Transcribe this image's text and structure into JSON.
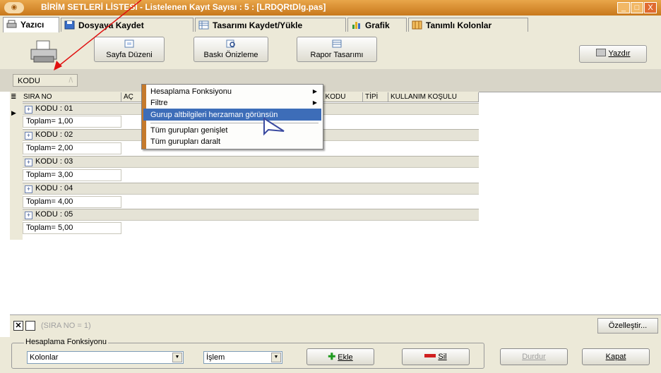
{
  "window": {
    "title": "BİRİM SETLERİ LİSTESİ  -  Listelenen Kayıt Sayısı : 5 : [LRDQRtDlg.pas]",
    "controls": [
      "_",
      "□",
      "X"
    ]
  },
  "tabs": [
    {
      "label": "Yazıcı",
      "icon": "printer-icon",
      "active": true
    },
    {
      "label": "Dosyaya Kaydet",
      "icon": "save-disk-icon"
    },
    {
      "label": "Tasarımı Kaydet/Yükle",
      "icon": "layout-icon"
    },
    {
      "label": "Grafik",
      "icon": "bar-chart-icon"
    },
    {
      "label": "Tanımlı Kolonlar",
      "icon": "columns-icon"
    }
  ],
  "toolbar": {
    "page_setup": "Sayfa Düzeni",
    "print_preview": "Baskı Önizleme",
    "report_design": "Rapor Tasarımı",
    "print": "Yazdır"
  },
  "group_panel": {
    "chip": "KODU",
    "sort_indicator": "/\\"
  },
  "grid": {
    "headers": [
      "SIRA NO",
      "AÇ",
      "İ KODU",
      "TİPİ",
      "KULLANIM KOŞULU"
    ],
    "groups": [
      {
        "label": "KODU : 01",
        "footer": "Toplam= 1,00"
      },
      {
        "label": "KODU : 02",
        "footer": "Toplam= 2,00"
      },
      {
        "label": "KODU : 03",
        "footer": "Toplam= 3,00"
      },
      {
        "label": "KODU : 04",
        "footer": "Toplam= 4,00"
      },
      {
        "label": "KODU : 05",
        "footer": "Toplam= 5,00"
      }
    ]
  },
  "context_menu": {
    "items": [
      {
        "label": "Hesaplama Fonksiyonu",
        "submenu": true
      },
      {
        "label": "Filtre",
        "submenu": true
      },
      {
        "label": "Gurup altbilgileri herzaman görünsün",
        "highlighted": true
      },
      {
        "label": "Tüm gurupları genişlet"
      },
      {
        "label": "Tüm gurupları daralt"
      }
    ]
  },
  "status": {
    "filter_text": "(SIRA NO = 1)",
    "customize": "Özelleştir..."
  },
  "bottom": {
    "group_title": "Hesaplama Fonksiyonu",
    "column_combo": "Kolonlar",
    "operation_combo": "İşlem",
    "add": "Ekle",
    "delete": "Sil",
    "stop": "Durdur",
    "close": "Kapat"
  },
  "colors": {
    "titlebar": "#d88a2e",
    "menu_highlight": "#3d6db8",
    "annotation_arrow": "#e01010"
  }
}
